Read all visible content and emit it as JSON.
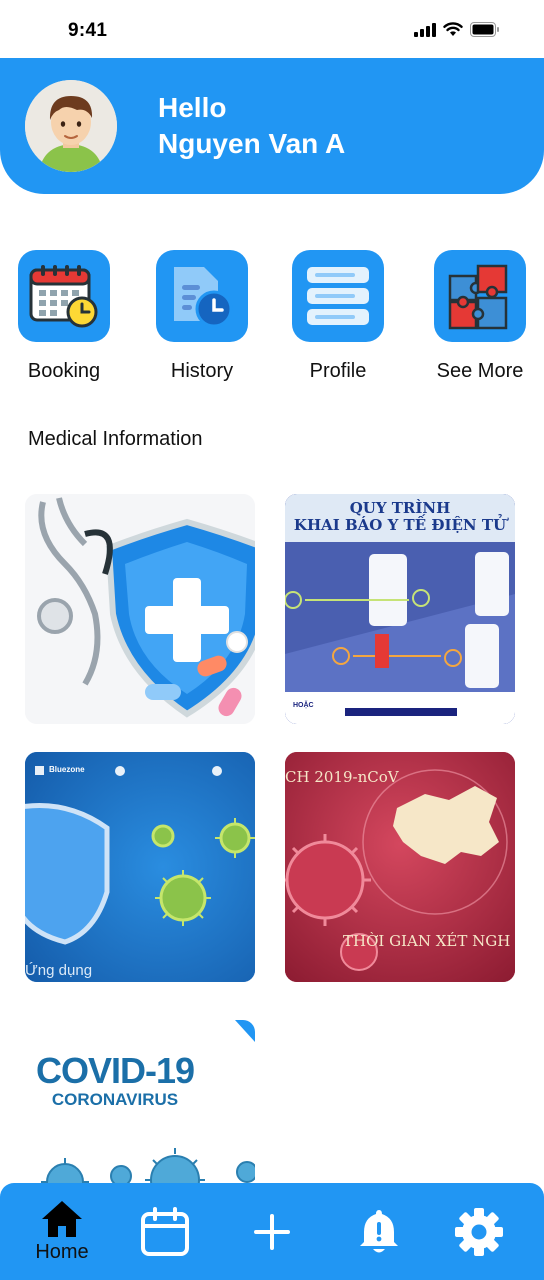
{
  "status_bar": {
    "time": "9:41",
    "icons": [
      "signal-icon",
      "wifi-icon",
      "battery-icon"
    ]
  },
  "header": {
    "greeting": "Hello",
    "user_name": "Nguyen Van A"
  },
  "actions": [
    {
      "label": "Booking",
      "icon": "calendar-clock-icon"
    },
    {
      "label": "History",
      "icon": "document-clock-icon"
    },
    {
      "label": "Profile",
      "icon": "server-list-icon"
    },
    {
      "label": "See More",
      "icon": "puzzle-icon"
    }
  ],
  "section": {
    "title": "Medical Information"
  },
  "cards": [
    {
      "name": "medical-shield-card"
    },
    {
      "name": "health-declaration-card",
      "title_line1": "QUY TRÌNH",
      "title_line2": "KHAI BÁO Y TẾ ĐIỆN TỬ",
      "labels": [
        "HOẶC"
      ]
    },
    {
      "name": "bluezone-card",
      "brand": "Bluezone",
      "caption": "Ứng dụng"
    },
    {
      "name": "ncov-card",
      "heading": "CH 2019-nCoV",
      "caption": "THỜI GIAN XÉT NGH"
    },
    {
      "name": "covid19-card",
      "title": "COVID-19",
      "subtitle": "CORONAVIRUS"
    }
  ],
  "bottom_nav": {
    "home_label": "Home",
    "items": [
      "home-icon",
      "calendar-icon",
      "plus-icon",
      "bell-alert-icon",
      "gear-icon"
    ]
  },
  "colors": {
    "primary": "#2196f3",
    "text": "#111111",
    "background": "#ffffff"
  }
}
